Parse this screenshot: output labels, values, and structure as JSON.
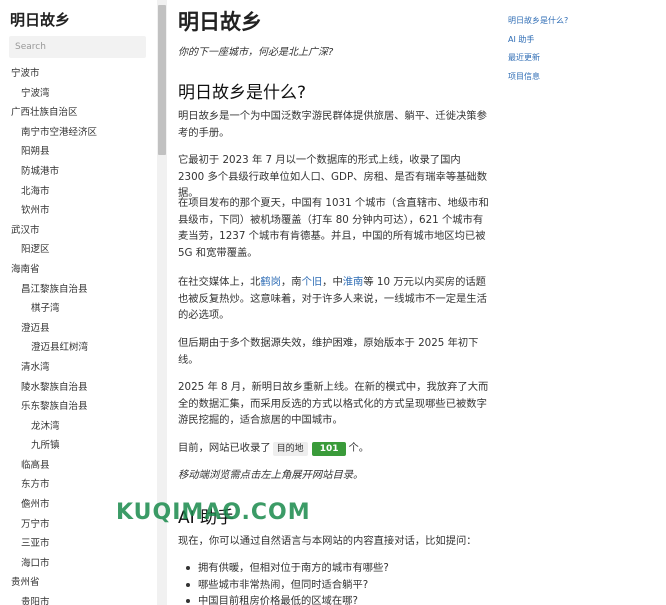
{
  "sidebar": {
    "site_title": "明日故乡",
    "search_placeholder": "Search",
    "nav": [
      {
        "label": "宁波市",
        "level": 1
      },
      {
        "label": "宁波湾",
        "level": 2
      },
      {
        "label": "广西壮族自治区",
        "level": 1
      },
      {
        "label": "南宁市空港经济区",
        "level": 2
      },
      {
        "label": "阳朔县",
        "level": 2
      },
      {
        "label": "防城港市",
        "level": 2
      },
      {
        "label": "北海市",
        "level": 2
      },
      {
        "label": "钦州市",
        "level": 2
      },
      {
        "label": "武汉市",
        "level": 1
      },
      {
        "label": "阳逻区",
        "level": 2
      },
      {
        "label": "海南省",
        "level": 1
      },
      {
        "label": "昌江黎族自治县",
        "level": 2
      },
      {
        "label": "棋子湾",
        "level": 3
      },
      {
        "label": "澄迈县",
        "level": 2
      },
      {
        "label": "澄迈县红树湾",
        "level": 3
      },
      {
        "label": "清水湾",
        "level": 2
      },
      {
        "label": "陵水黎族自治县",
        "level": 2
      },
      {
        "label": "乐东黎族自治县",
        "level": 2
      },
      {
        "label": "龙沐湾",
        "level": 3
      },
      {
        "label": "九所镇",
        "level": 3
      },
      {
        "label": "临高县",
        "level": 2
      },
      {
        "label": "东方市",
        "level": 2
      },
      {
        "label": "儋州市",
        "level": 2
      },
      {
        "label": "万宁市",
        "level": 2
      },
      {
        "label": "三亚市",
        "level": 2
      },
      {
        "label": "海口市",
        "level": 2
      },
      {
        "label": "贵州省",
        "level": 1
      },
      {
        "label": "贵阳市",
        "level": 2
      }
    ]
  },
  "main": {
    "title": "明日故乡",
    "subtitle": "你的下一座城市，何必是北上广深?",
    "h_what": "明日故乡是什么?",
    "p1": "明日故乡是一个为中国泛数字游民群体提供旅居、躺平、迁徙决策参考的手册。",
    "p2": "它最初于 2023 年 7 月以一个数据库的形式上线，收录了国内 2300 多个县级行政单位如人口、GDP、房租、是否有瑞幸等基础数据。",
    "p3": "在项目发布的那个夏天，中国有 1031 个城市（含直辖市、地级市和县级市，下同）被机场覆盖（打车 80 分钟内可达），621 个城市有麦当劳，1237 个城市有肯德基。并且，中国的所有城市地区均已被 5G 和宽带覆盖。",
    "p4_a": "在社交媒体上，北",
    "p4_link1": "鹤岗",
    "p4_b": "，南",
    "p4_link2": "个旧",
    "p4_c": "，中",
    "p4_link3": "淮南",
    "p4_d": "等 10 万元以内买房的话题也被反复热炒。这意味着，对于许多人来说，一线城市不一定是生活的必选项。",
    "p5": "但后期由于多个数据源失效，维护困难，原始版本于 2025 年初下线。",
    "p6": "2025 年 8 月，新明日故乡重新上线。在新的模式中，我放弃了大而全的数据汇集，而采用反选的方式以格式化的方式呈现哪些已被数字游民挖掘的，适合旅居的中国城市。",
    "p7_a": "目前，网站已收录了",
    "p7_tag": "目的地",
    "p7_count": "101",
    "p7_b": "个。",
    "p8": "移动端浏览需点击左上角展开网站目录。",
    "h_ai": "AI 助手",
    "p9": "现在，你可以通过自然语言与本网站的内容直接对话，比如提问：",
    "ai_questions": [
      "拥有供暖，但相对位于南方的城市有哪些?",
      "哪些城市非常热闹，但同时适合躺平?",
      "中国目前租房价格最低的区域在哪?"
    ]
  },
  "toc": [
    "明日故乡是什么?",
    "AI 助手",
    "最近更新",
    "项目信息"
  ],
  "watermark": "KUQIMAO.COM",
  "colors": {
    "link": "#2f6db5",
    "count_badge": "#3a9b3a",
    "watermark": "#1a8a4c"
  }
}
